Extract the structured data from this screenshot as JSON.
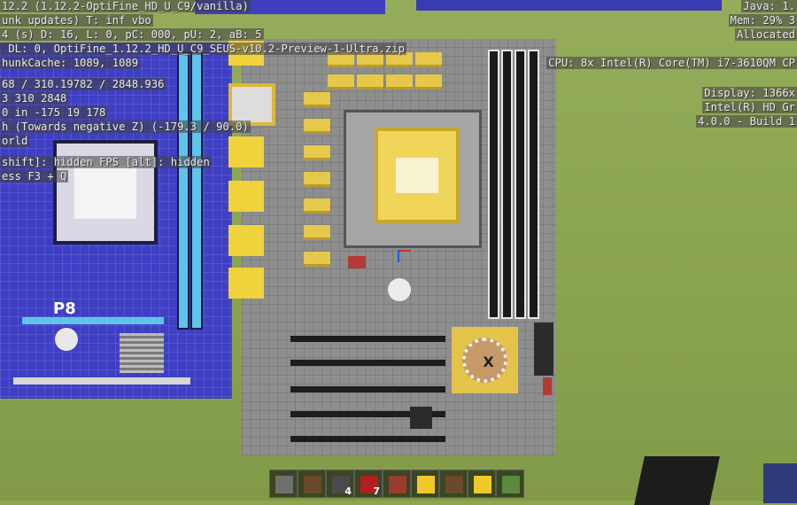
{
  "game": "Minecraft",
  "debug_left": [
    "12.2 (1.12.2-OptiFine_HD_U_C9/vanilla)",
    "unk updates) T: inf vbo",
    "4 (s) D: 16, L: 0, pC: 000, pU: 2, aB: 5",
    " DL: 0, OptiFine_1.12.2_HD_U_C9_SEUS-v10.2-Preview-1-Ultra.zip",
    "hunkCache: 1089, 1089",
    "68 / 310.19782 / 2848.936",
    "3 310 2848",
    "0 in -175 19 178",
    "h (Towards negative Z) (-179.3 / 90.0)",
    "orld",
    "shift]: hidden FPS [alt]: hidden",
    "ess F3 + Q"
  ],
  "debug_right": [
    "Java: 1.",
    "Mem: 29% 3",
    "Allocated",
    "",
    "CPU: 8x Intel(R) Core(TM) i7-3610QM CP",
    "",
    "Display: 1366x",
    "Intel(R) HD Gr",
    "4.0.0 - Build 1"
  ],
  "board_left": {
    "logo": "P8"
  },
  "board_main": {
    "pch_mark": "X"
  },
  "hotbar": {
    "slots": [
      {
        "item": "stone-block",
        "color": "#6f6f6f",
        "count": ""
      },
      {
        "item": "wood-log-block",
        "color": "#6b4a2b",
        "count": ""
      },
      {
        "item": "stone-button-item",
        "color": "#4a4a4a",
        "count": "4"
      },
      {
        "item": "redstone-dust-item",
        "color": "#b41e1e",
        "count": "7"
      },
      {
        "item": "redstone-repeater-item",
        "color": "#9a3b2e",
        "count": ""
      },
      {
        "item": "gold-block",
        "color": "#f0c82a",
        "count": ""
      },
      {
        "item": "wood-log-block",
        "color": "#6b4a2b",
        "count": ""
      },
      {
        "item": "gold-block",
        "color": "#f0c82a",
        "count": ""
      },
      {
        "item": "grass-block",
        "color": "#5a8a3a",
        "count": ""
      }
    ]
  }
}
